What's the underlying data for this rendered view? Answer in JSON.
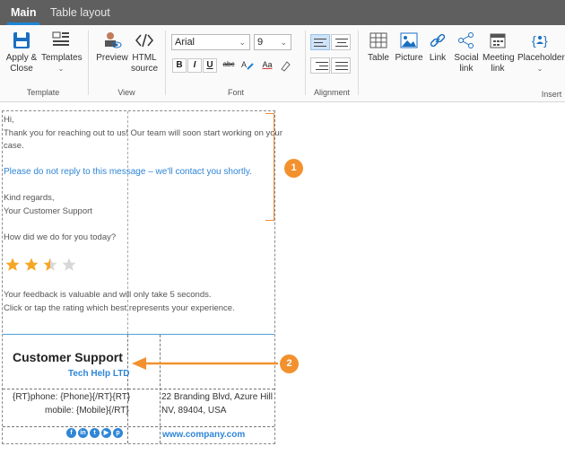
{
  "tabs": [
    {
      "label": "Main",
      "active": true
    },
    {
      "label": "Table layout",
      "active": false
    }
  ],
  "ribbon": {
    "template_group": {
      "label": "Template",
      "apply_close": "Apply & Close",
      "templates": "Templates"
    },
    "view_group": {
      "label": "View",
      "preview": "Preview",
      "html_source": "HTML source"
    },
    "font_group": {
      "label": "Font",
      "font_family": "Arial",
      "font_size": "9",
      "bold": "B",
      "italic": "I",
      "underline": "U",
      "strike": "abc",
      "font_color_letters": "Aa"
    },
    "alignment_group": {
      "label": "Alignment"
    },
    "insert_group": {
      "label": "Insert",
      "table": "Table",
      "picture": "Picture",
      "link": "Link",
      "social_link": "Social link",
      "meeting_link": "Meeting link",
      "placeholder": "Placeholder"
    }
  },
  "template": {
    "greeting": "Hi,",
    "body_line_1": "Thank you for reaching out to us! Our team will soon start working on your",
    "body_line_2": "case.",
    "notice": "Please do not reply to this message – we'll contact you shortly.",
    "closing": "Kind regards,",
    "sender": "Your Customer Support",
    "question": "How did we do for you today?",
    "rating": {
      "filled": 2.5,
      "max": 5
    },
    "feedback_1": "Your feedback is valuable and will only take 5 seconds.",
    "feedback_2": "Click or tap the rating which best represents your experience."
  },
  "signature": {
    "name": "Customer Support",
    "company": "Tech Help LTD",
    "phone": "{RT}phone: {Phone}{/RT}{RT}",
    "mobile": "mobile: {Mobile}{/RT}",
    "address_1": "22 Branding Blvd, Azure Hill",
    "address_2": "NV, 89404, USA",
    "website": "www.company.com",
    "social_icons": [
      "facebook-icon",
      "linkedin-icon",
      "twitter-icon",
      "youtube-icon",
      "pinterest-icon"
    ]
  },
  "callouts": [
    "1",
    "2"
  ],
  "colors": {
    "accent": "#1b86d6",
    "callout": "#f2912e",
    "link": "#2f86d6",
    "star": "#f5a623"
  }
}
